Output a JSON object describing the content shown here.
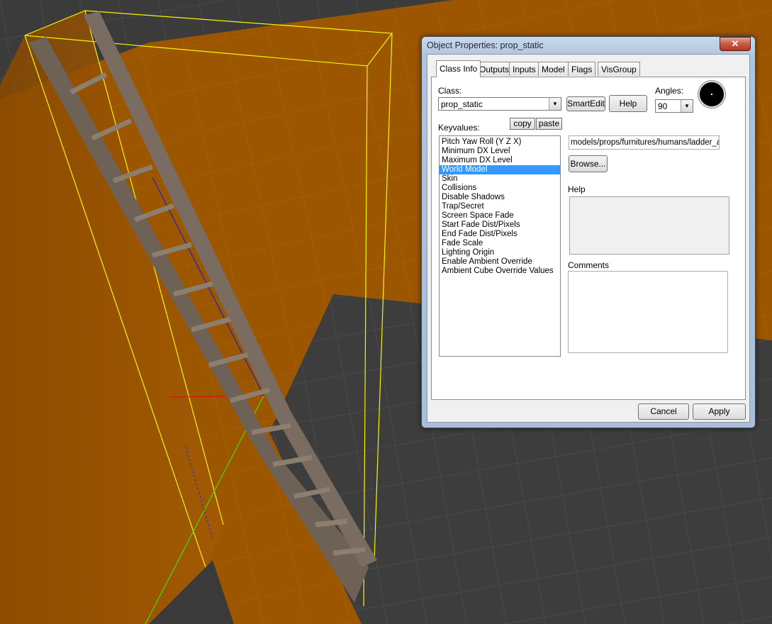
{
  "dialog": {
    "title": "Object Properties: prop_static",
    "close_glyph": "✕",
    "tabs": [
      "Class Info",
      "Outputs",
      "Inputs",
      "Model",
      "Flags",
      "VisGroup"
    ],
    "class_label": "Class:",
    "class_value": "prop_static",
    "smartedit_label": "SmartEdit",
    "help_button_label": "Help",
    "angles_label": "Angles:",
    "angles_value": "90",
    "keyvalues_label": "Keyvalues:",
    "copy_label": "copy",
    "paste_label": "paste",
    "keyvalues": [
      "Pitch Yaw Roll (Y Z X)",
      "Minimum DX Level",
      "Maximum DX Level",
      "World Model",
      "Skin",
      "Collisions",
      "Disable Shadows",
      "Trap/Secret",
      "Screen Space Fade",
      "Start Fade Dist/Pixels",
      "End Fade Dist/Pixels",
      "Fade Scale",
      "Lighting Origin",
      "Enable Ambient Override",
      "Ambient Cube Override Values"
    ],
    "selected_keyvalue": "World Model",
    "model_path": "models/props/furnitures/humans/ladder_a.m",
    "browse_label": "Browse...",
    "help_section_label": "Help",
    "comments_label": "Comments",
    "cancel_label": "Cancel",
    "apply_label": "Apply"
  },
  "colors": {
    "floor_orange": "#a45a00",
    "wall_orange": "#8c4b00",
    "gray_floor": "#3c3c3c",
    "selection_box": "#f0f000",
    "list_selection": "#3399ff"
  },
  "icons": {
    "combo_arrow": "▼"
  }
}
